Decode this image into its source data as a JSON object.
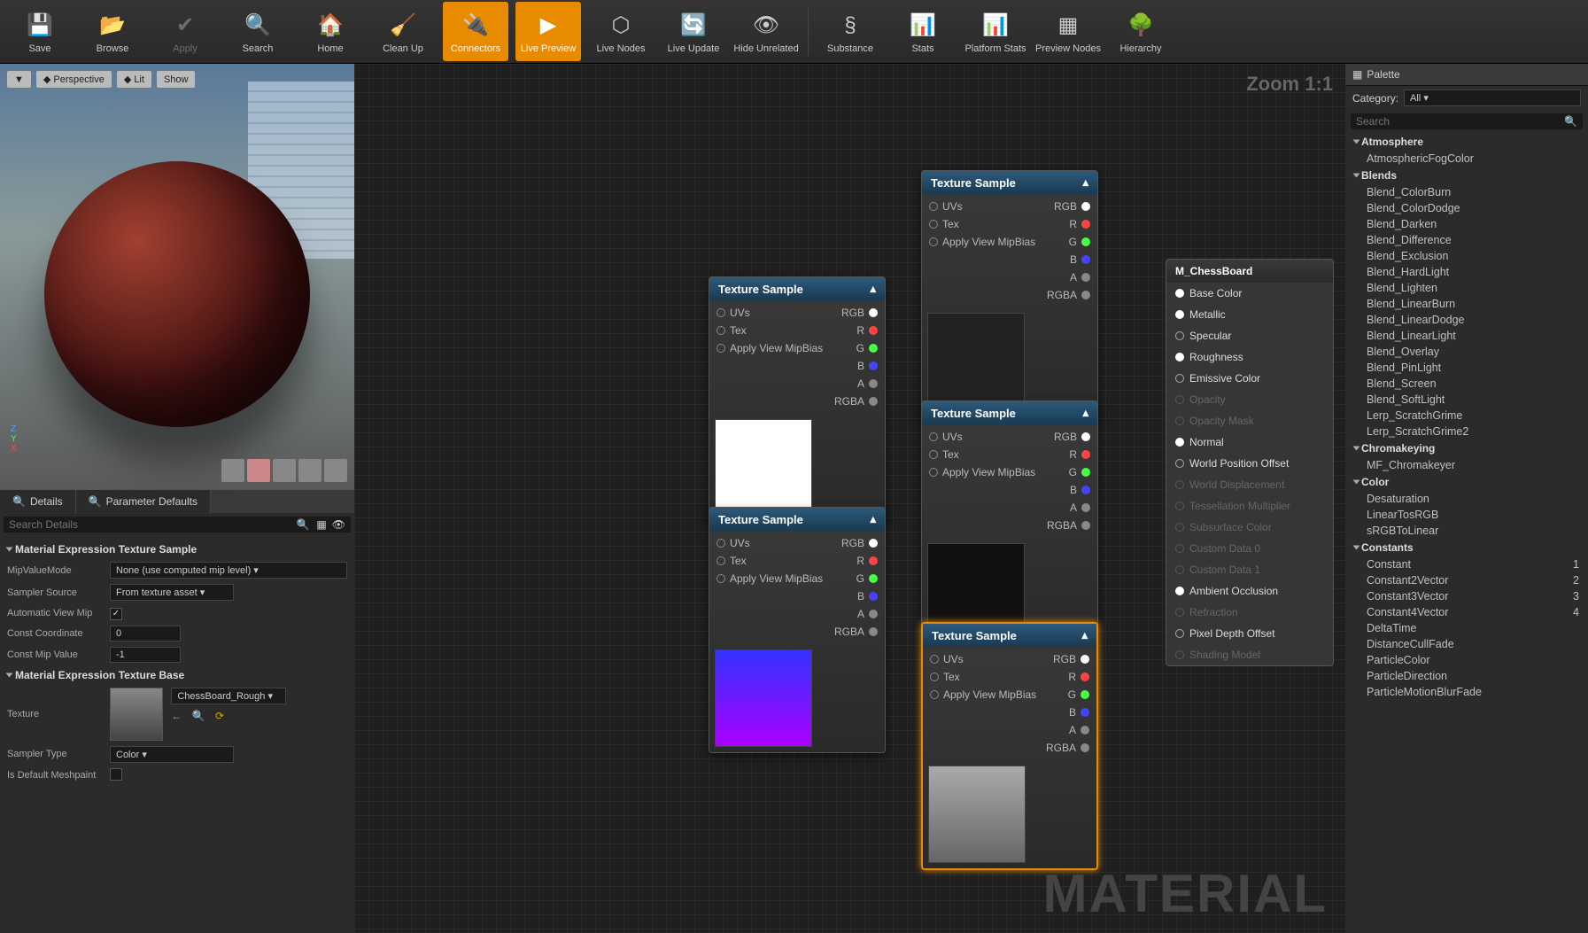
{
  "toolbar": [
    {
      "label": "Save",
      "active": false,
      "disabled": false
    },
    {
      "label": "Browse",
      "active": false,
      "disabled": false
    },
    {
      "label": "Apply",
      "active": false,
      "disabled": true
    },
    {
      "label": "Search",
      "active": false,
      "disabled": false
    },
    {
      "label": "Home",
      "active": false,
      "disabled": false
    },
    {
      "label": "Clean Up",
      "active": false,
      "disabled": false
    },
    {
      "label": "Connectors",
      "active": true,
      "disabled": false
    },
    {
      "label": "Live Preview",
      "active": true,
      "disabled": false
    },
    {
      "label": "Live Nodes",
      "active": false,
      "disabled": false
    },
    {
      "label": "Live Update",
      "active": false,
      "disabled": false
    },
    {
      "label": "Hide Unrelated",
      "active": false,
      "disabled": false
    },
    {
      "label": "Substance",
      "active": false,
      "disabled": false
    },
    {
      "label": "Stats",
      "active": false,
      "disabled": false
    },
    {
      "label": "Platform Stats",
      "active": false,
      "disabled": false
    },
    {
      "label": "Preview Nodes",
      "active": false,
      "disabled": false
    },
    {
      "label": "Hierarchy",
      "active": false,
      "disabled": false
    }
  ],
  "viewport": {
    "buttons": {
      "perspective": "Perspective",
      "lit": "Lit",
      "show": "Show"
    }
  },
  "details_tabs": {
    "details": "Details",
    "params": "Parameter Defaults"
  },
  "details": {
    "search_placeholder": "Search Details",
    "sections": {
      "texsample": "Material Expression Texture Sample",
      "texbase": "Material Expression Texture Base"
    },
    "mip_mode": {
      "label": "MipValueMode",
      "value": "None (use computed mip level)"
    },
    "sampler_source": {
      "label": "Sampler Source",
      "value": "From texture asset"
    },
    "auto_view_mip": {
      "label": "Automatic View Mip",
      "checked": true
    },
    "const_coord": {
      "label": "Const Coordinate",
      "value": "0"
    },
    "const_mip": {
      "label": "Const Mip Value",
      "value": "-1"
    },
    "texture": {
      "label": "Texture",
      "asset": "ChessBoard_Rough"
    },
    "sampler_type": {
      "label": "Sampler Type",
      "value": "Color"
    },
    "is_default_meshpaint": {
      "label": "Is Default Meshpaint",
      "checked": false
    }
  },
  "graph": {
    "zoom": "Zoom 1:1",
    "watermark": "MATERIAL",
    "node_title": "Texture Sample",
    "inputs": [
      "UVs",
      "Tex",
      "Apply View MipBias"
    ],
    "outputs": [
      "RGB",
      "R",
      "G",
      "B",
      "A",
      "RGBA"
    ],
    "mat_node": {
      "title": "M_ChessBoard",
      "pins": [
        {
          "label": "Base Color",
          "enabled": true,
          "solid": true
        },
        {
          "label": "Metallic",
          "enabled": true,
          "solid": true
        },
        {
          "label": "Specular",
          "enabled": true,
          "solid": false
        },
        {
          "label": "Roughness",
          "enabled": true,
          "solid": true
        },
        {
          "label": "Emissive Color",
          "enabled": true,
          "solid": false
        },
        {
          "label": "Opacity",
          "enabled": false,
          "solid": false
        },
        {
          "label": "Opacity Mask",
          "enabled": false,
          "solid": false
        },
        {
          "label": "Normal",
          "enabled": true,
          "solid": true
        },
        {
          "label": "World Position Offset",
          "enabled": true,
          "solid": false
        },
        {
          "label": "World Displacement",
          "enabled": false,
          "solid": false
        },
        {
          "label": "Tessellation Multiplier",
          "enabled": false,
          "solid": false
        },
        {
          "label": "Subsurface Color",
          "enabled": false,
          "solid": false
        },
        {
          "label": "Custom Data 0",
          "enabled": false,
          "solid": false
        },
        {
          "label": "Custom Data 1",
          "enabled": false,
          "solid": false
        },
        {
          "label": "Ambient Occlusion",
          "enabled": true,
          "solid": true
        },
        {
          "label": "Refraction",
          "enabled": false,
          "solid": false
        },
        {
          "label": "Pixel Depth Offset",
          "enabled": true,
          "solid": false
        },
        {
          "label": "Shading Model",
          "enabled": false,
          "solid": false
        }
      ]
    }
  },
  "palette": {
    "title": "Palette",
    "category_label": "Category:",
    "category_value": "All",
    "search_placeholder": "Search",
    "categories": [
      {
        "name": "Atmosphere",
        "items": [
          {
            "label": "AtmosphericFogColor"
          }
        ]
      },
      {
        "name": "Blends",
        "items": [
          {
            "label": "Blend_ColorBurn"
          },
          {
            "label": "Blend_ColorDodge"
          },
          {
            "label": "Blend_Darken"
          },
          {
            "label": "Blend_Difference"
          },
          {
            "label": "Blend_Exclusion"
          },
          {
            "label": "Blend_HardLight"
          },
          {
            "label": "Blend_Lighten"
          },
          {
            "label": "Blend_LinearBurn"
          },
          {
            "label": "Blend_LinearDodge"
          },
          {
            "label": "Blend_LinearLight"
          },
          {
            "label": "Blend_Overlay"
          },
          {
            "label": "Blend_PinLight"
          },
          {
            "label": "Blend_Screen"
          },
          {
            "label": "Blend_SoftLight"
          },
          {
            "label": "Lerp_ScratchGrime"
          },
          {
            "label": "Lerp_ScratchGrime2"
          }
        ]
      },
      {
        "name": "Chromakeying",
        "items": [
          {
            "label": "MF_Chromakeyer"
          }
        ]
      },
      {
        "name": "Color",
        "items": [
          {
            "label": "Desaturation"
          },
          {
            "label": "LinearTosRGB"
          },
          {
            "label": "sRGBToLinear"
          }
        ]
      },
      {
        "name": "Constants",
        "items": [
          {
            "label": "Constant",
            "shortcut": "1"
          },
          {
            "label": "Constant2Vector",
            "shortcut": "2"
          },
          {
            "label": "Constant3Vector",
            "shortcut": "3"
          },
          {
            "label": "Constant4Vector",
            "shortcut": "4"
          },
          {
            "label": "DeltaTime"
          },
          {
            "label": "DistanceCullFade"
          },
          {
            "label": "ParticleColor"
          },
          {
            "label": "ParticleDirection"
          },
          {
            "label": "ParticleMotionBlurFade"
          }
        ]
      }
    ]
  }
}
